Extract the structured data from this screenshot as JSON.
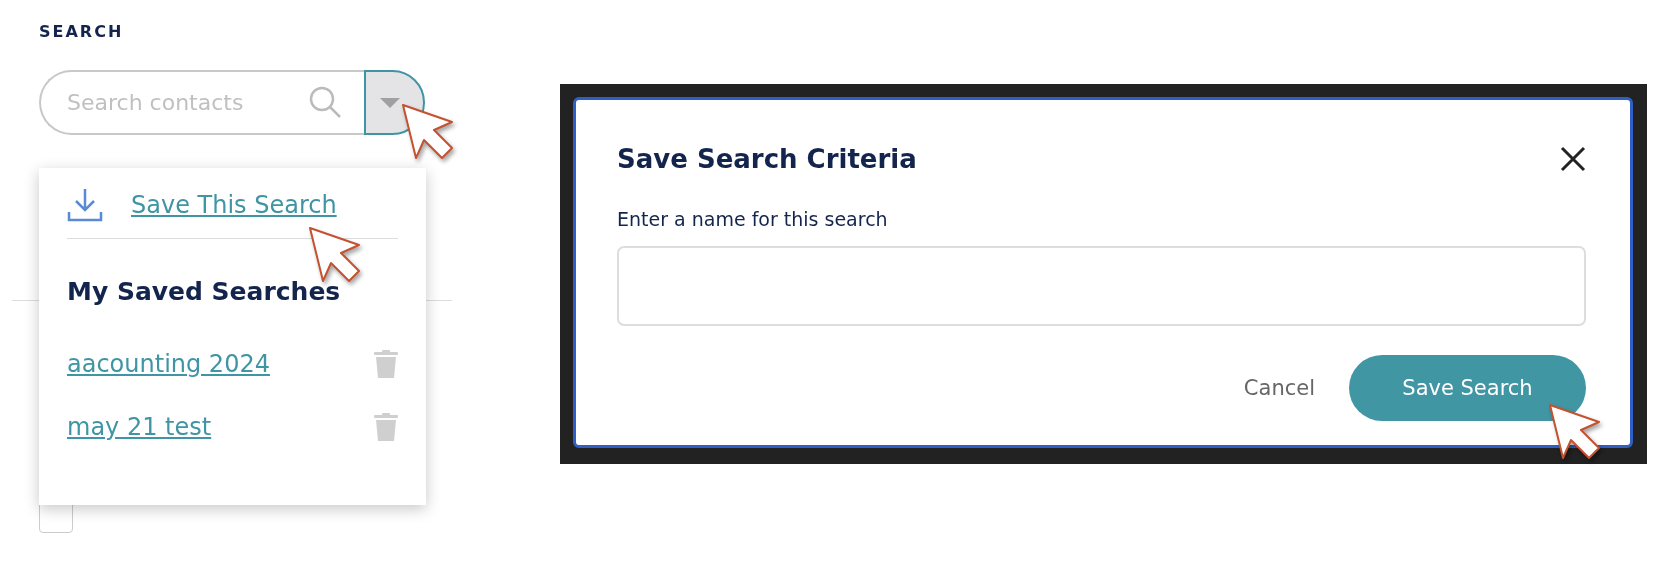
{
  "search": {
    "heading": "SEARCH",
    "placeholder": "Search contacts",
    "dropdown_open": true
  },
  "dropdown": {
    "save_link": "Save This Search",
    "saved_heading": "My Saved Searches",
    "saved_searches": [
      {
        "name": "aacounting 2024"
      },
      {
        "name": "may 21 test"
      }
    ]
  },
  "background_checkbox": {
    "checked": false
  },
  "dialog": {
    "title": "Save Search Criteria",
    "field_label": "Enter a name for this search",
    "cancel": "Cancel",
    "submit": "Save Search"
  }
}
